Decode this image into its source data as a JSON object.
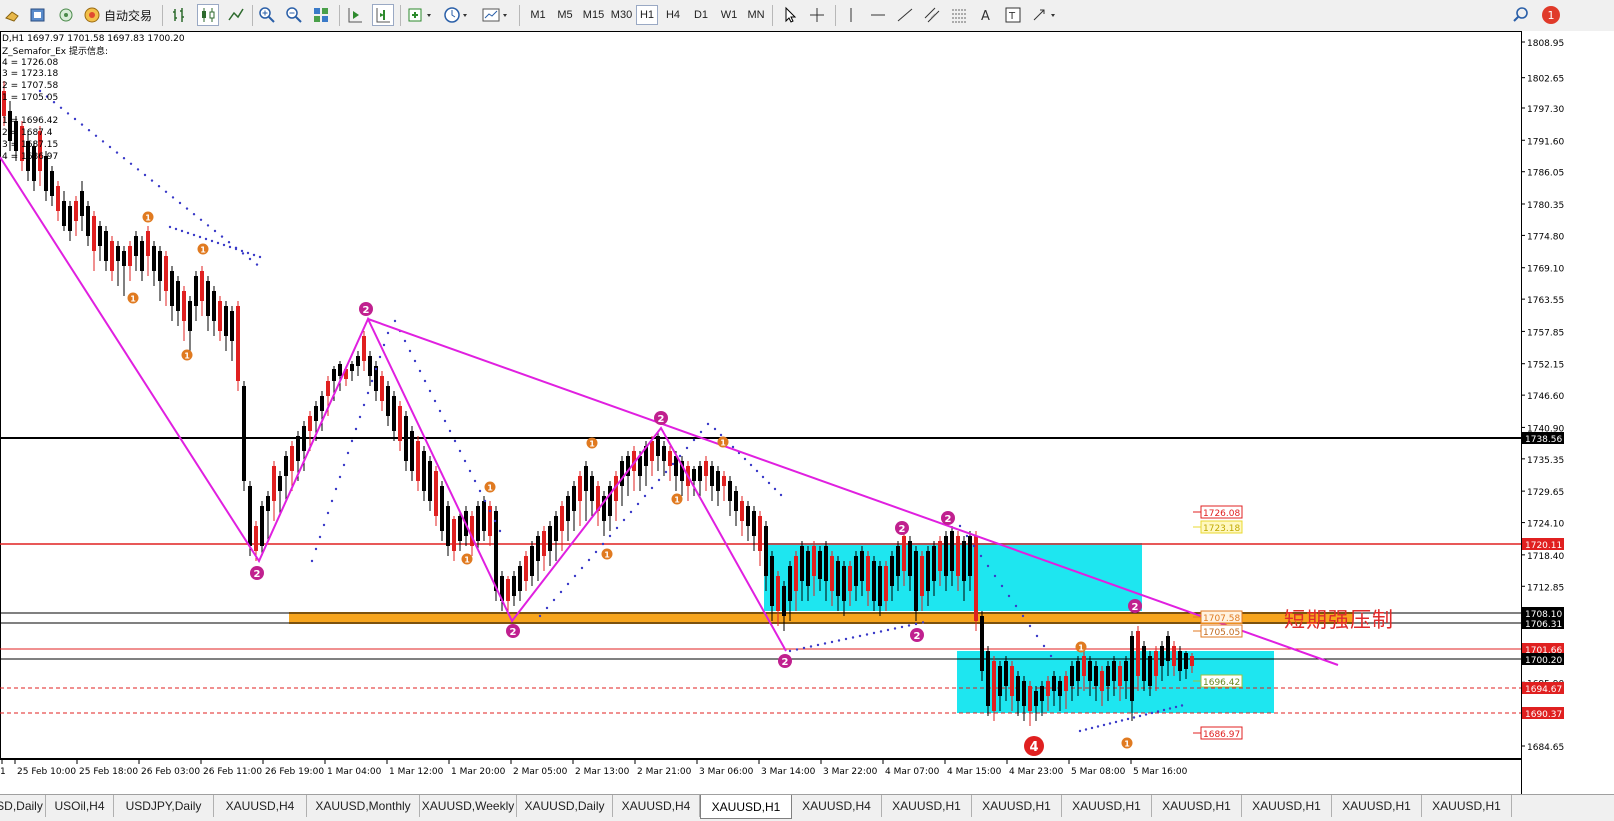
{
  "toolbar": {
    "autotrade_label": "自动交易",
    "timeframes": [
      "M1",
      "M5",
      "M15",
      "M30",
      "H1",
      "H4",
      "D1",
      "W1",
      "MN"
    ],
    "active_timeframe": "H1",
    "notification_count": "1"
  },
  "chart": {
    "header": "D,H1  1697.97 1701.58 1697.83 1700.20",
    "indicator_name": "Z_Semafor_Ex 提示信息:",
    "indicator_lines": [
      "4 = 1726.08",
      "3 = 1723.18",
      "2 = 1707.58",
      "1 = 1705.05",
      "1 = 1696.42",
      "2 = 1687.4",
      "3 = 1687.15",
      "4 = 1686.97"
    ],
    "annotation": "短期强压制",
    "price_axis": [
      "1808.95",
      "1802.65",
      "1797.30",
      "1791.60",
      "1786.05",
      "1780.35",
      "1774.80",
      "1769.10",
      "1763.55",
      "1757.85",
      "1752.15",
      "1746.60",
      "1740.90",
      "1735.35",
      "1729.65",
      "1724.10",
      "1718.40",
      "1712.85",
      "1707.15",
      "1701.45",
      "1695.90",
      "1690.20",
      "1684.65"
    ],
    "price_markers": [
      {
        "value": "1738.56",
        "bg": "#000000",
        "fg": "#ffffff"
      },
      {
        "value": "1720.11",
        "bg": "#e02020",
        "fg": "#ffffff"
      },
      {
        "value": "1708.10",
        "bg": "#000000",
        "fg": "#ffffff"
      },
      {
        "value": "1706.31",
        "bg": "#000000",
        "fg": "#ffffff"
      },
      {
        "value": "1701.66",
        "bg": "#e02020",
        "fg": "#ffffff"
      },
      {
        "value": "1700.20",
        "bg": "#000000",
        "fg": "#ffffff"
      },
      {
        "value": "1694.67",
        "bg": "#e02020",
        "fg": "#ffffff"
      },
      {
        "value": "1690.37",
        "bg": "#e02020",
        "fg": "#ffffff"
      }
    ],
    "level_labels": [
      "1726.08",
      "1723.18",
      "1707.58",
      "1705.05",
      "1696.42",
      "1686.97"
    ],
    "time_axis": [
      "25 Feb 10:00",
      "25 Feb 18:00",
      "26 Feb 03:00",
      "26 Feb 11:00",
      "26 Feb 19:00",
      "1 Mar 04:00",
      "1 Mar 12:00",
      "1 Mar 20:00",
      "2 Mar 05:00",
      "2 Mar 13:00",
      "2 Mar 21:00",
      "3 Mar 06:00",
      "3 Mar 14:00",
      "3 Mar 22:00",
      "4 Mar 07:00",
      "4 Mar 15:00",
      "4 Mar 23:00",
      "5 Mar 08:00",
      "5 Mar 16:00"
    ]
  },
  "tabs": {
    "items": [
      "SD,Daily",
      "USOil,H4",
      "USDJPY,Daily",
      "XAUUSD,H4",
      "XAUUSD,Monthly",
      "XAUUSD,Weekly",
      "XAUUSD,Daily",
      "XAUUSD,H4",
      "XAUUSD,H1",
      "XAUUSD,H4",
      "XAUUSD,H1",
      "XAUUSD,H1",
      "XAUUSD,H1",
      "XAUUSD,H1",
      "XAUUSD,H1",
      "XAUUSD,H1",
      "XAUUSD,H1"
    ],
    "active_index": 8
  },
  "colors": {
    "bull": "#e02020",
    "bear": "#000000",
    "zigzag": "#e020e0",
    "zone": "#1ee6f0",
    "orange_band": "#f7a51e",
    "semafor_2": "#c0208f",
    "semafor_1": "#e07a20"
  }
}
